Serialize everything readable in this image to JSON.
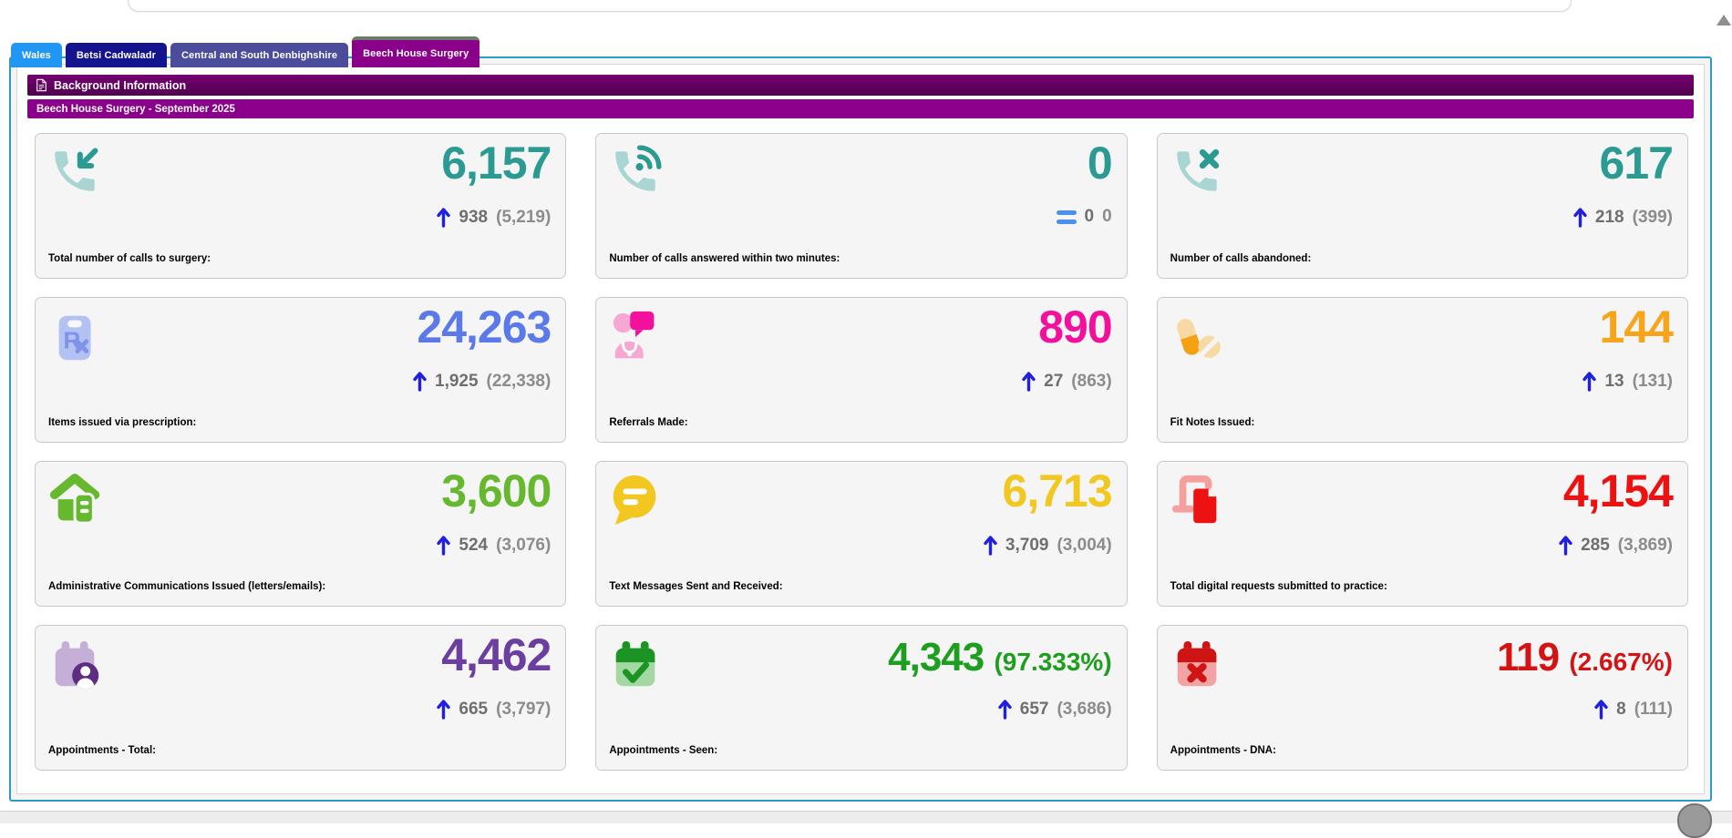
{
  "tabs": [
    {
      "label": "Wales",
      "color": "#2196f3",
      "active": false
    },
    {
      "label": "Betsi Cadwaladr",
      "color": "#14148f",
      "active": false
    },
    {
      "label": "Central and South Denbighshire",
      "color": "#4c4c9c",
      "active": false
    },
    {
      "label": "Beech House Surgery",
      "color": "#8a008a",
      "active": true,
      "active_strip_color": "#6b7d68"
    }
  ],
  "header": {
    "title": "Background Information",
    "subtitle": "Beech House Surgery - September 2025",
    "title_bar_color": "#730070",
    "subtitle_bar_color": "#8b008b"
  },
  "colors": {
    "frame_border": "#2a9ec0",
    "arrow_up": "#2121dd",
    "equals": "#4a90f2",
    "change_text": "#6f6f6f",
    "previous_text": "#8c8c8c"
  },
  "cards": [
    {
      "label": "Total number of calls to surgery:",
      "value": "6,157",
      "value_color": "#2b9a92",
      "icon": "phone-incoming-icon",
      "icon_colors": {
        "light": "#a9d6d2",
        "dark": "#2b9a92"
      },
      "trend": "up",
      "change": "938",
      "previous": "(5,219)"
    },
    {
      "label": "Number of calls answered within two minutes:",
      "value": "0",
      "value_color": "#2b9a92",
      "icon": "phone-volume-icon",
      "icon_colors": {
        "light": "#a9d6d2",
        "dark": "#2b9a92"
      },
      "trend": "equal",
      "change": "0",
      "previous": "0"
    },
    {
      "label": "Number of calls abandoned:",
      "value": "617",
      "value_color": "#2b9a92",
      "icon": "phone-x-icon",
      "icon_colors": {
        "light": "#a9d6d2",
        "dark": "#2b9a92"
      },
      "trend": "up",
      "change": "218",
      "previous": "(399)"
    },
    {
      "label": "Items issued via prescription:",
      "value": "24,263",
      "value_color": "#5b79e8",
      "icon": "prescription-icon",
      "icon_colors": {
        "light": "#b4c1f4",
        "dark": "#8093ea"
      },
      "trend": "up",
      "change": "1,925",
      "previous": "(22,338)"
    },
    {
      "label": "Referrals Made:",
      "value": "890",
      "value_color": "#f2119d",
      "icon": "referral-icon",
      "icon_colors": {
        "light": "#f6a8d2",
        "dark": "#f2119d"
      },
      "trend": "up",
      "change": "27",
      "previous": "(863)"
    },
    {
      "label": "Fit Notes Issued:",
      "value": "144",
      "value_color": "#f7a51b",
      "icon": "pills-icon",
      "icon_colors": {
        "light": "#f8d9a4",
        "dark": "#f5a114"
      },
      "trend": "up",
      "change": "13",
      "previous": "(131)"
    },
    {
      "label": "Administrative Communications Issued (letters/emails):",
      "value": "3,600",
      "value_color": "#66b92e",
      "icon": "house-mail-icon",
      "icon_colors": {
        "light": "#66b92e",
        "dark": "#66b92e"
      },
      "trend": "up",
      "change": "524",
      "previous": "(3,076)"
    },
    {
      "label": "Text Messages Sent and Received:",
      "value": "6,713",
      "value_color": "#f2c71f",
      "icon": "chat-bubble-icon",
      "icon_colors": {
        "light": "#f2c71f",
        "dark": "#f2c71f"
      },
      "trend": "up",
      "change": "3,709",
      "previous": "(3,004)"
    },
    {
      "label": "Total digital requests submitted to practice:",
      "value": "4,154",
      "value_color": "#ee1111",
      "icon": "digital-request-icon",
      "icon_colors": {
        "light": "#f59f9f",
        "dark": "#ee1111"
      },
      "trend": "up",
      "change": "285",
      "previous": "(3,869)"
    },
    {
      "label": "Appointments - Total:",
      "value": "4,462",
      "value_color": "#6b3fa0",
      "icon": "calendar-person-icon",
      "icon_colors": {
        "light": "#c6afd7",
        "dark": "#5e2c82"
      },
      "trend": "up",
      "change": "665",
      "previous": "(3,797)"
    },
    {
      "label": "Appointments - Seen:",
      "value": "4,343",
      "value_suffix": "(97.333%)",
      "value_color": "#1e9e1e",
      "icon": "calendar-check-icon",
      "icon_colors": {
        "light": "#a3d8a3",
        "dark": "#1b9423"
      },
      "trend": "up",
      "change": "657",
      "previous": "(3,686)"
    },
    {
      "label": "Appointments - DNA:",
      "value": "119",
      "value_suffix": "(2.667%)",
      "value_color": "#d41414",
      "icon": "calendar-x-icon",
      "icon_colors": {
        "light": "#f2a4a4",
        "dark": "#cf1414"
      },
      "trend": "up",
      "change": "8",
      "previous": "(111)"
    }
  ]
}
